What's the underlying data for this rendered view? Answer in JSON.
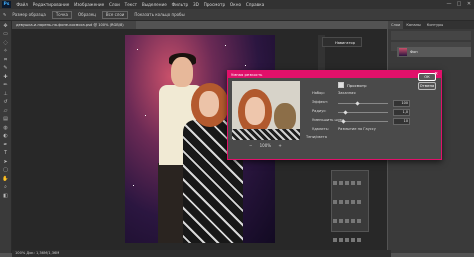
{
  "menubar": {
    "logo": "Ps",
    "items": [
      "Файл",
      "Редактирование",
      "Изображение",
      "Слои",
      "Текст",
      "Выделение",
      "Фильтр",
      "3D",
      "Просмотр",
      "Окно",
      "Справка"
    ],
    "minimize": "—",
    "maximize": "□",
    "close": "✕"
  },
  "options": {
    "items": [
      "Размер образца",
      "Точка",
      "Образец",
      "Все слои",
      "Показать кольцо пробы"
    ]
  },
  "document": {
    "tab": "девушка-и-парень-на-фоне-космоса.psd @ 100% (RGB/8)",
    "status": "100%  Док: 1,36M/1,36M"
  },
  "right_panel": {
    "tabs": [
      "Слои",
      "Каналы",
      "Контуры"
    ],
    "layer_name": "Фон"
  },
  "navigator": {
    "label": "Навигатор"
  },
  "dialog": {
    "title": "Умная резкость",
    "close": "✕",
    "preview_label": "Просмотр",
    "preset_label": "Набор:",
    "preset_value": "Заказная",
    "amount_label": "Эффект:",
    "amount_value": "100",
    "radius_label": "Радиус:",
    "radius_value": "1,0",
    "noise_label": "Уменьшить шум:",
    "noise_value": "10",
    "remove_label": "Удалить:",
    "remove_value": "Размытие по Гауссу",
    "shadows_label": "Тени/света",
    "zoom_out": "−",
    "zoom_level": "100%",
    "zoom_in": "+",
    "ok_label": "ОК",
    "cancel_label": "Отмена",
    "accent_color": "#e0106a"
  }
}
